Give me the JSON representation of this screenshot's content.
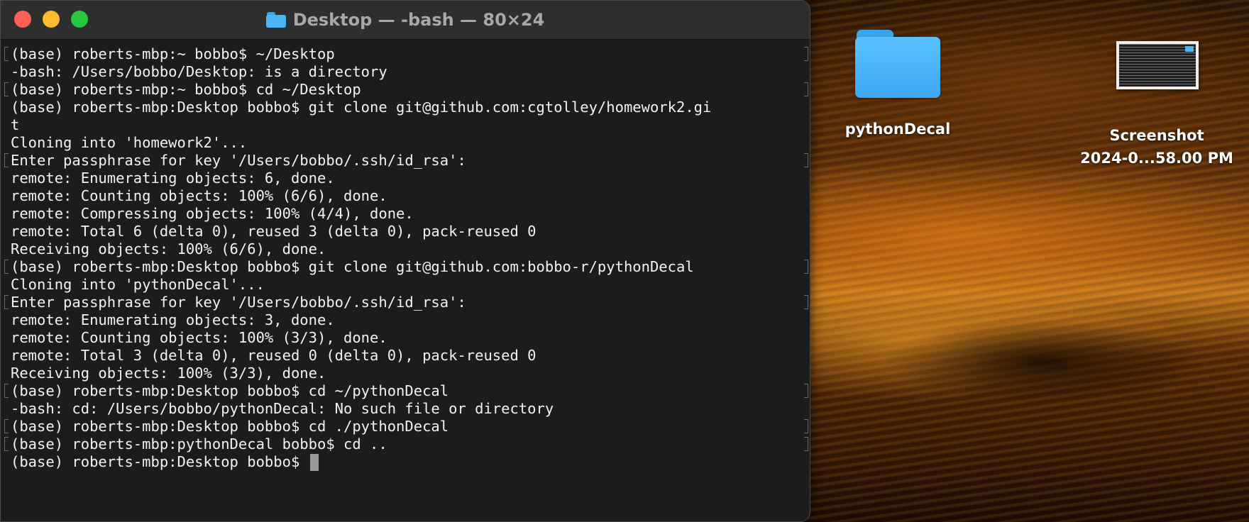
{
  "window": {
    "title": "Desktop — -bash — 80×24",
    "title_icon": "folder-icon"
  },
  "terminal": {
    "lines": [
      {
        "text": "(base) roberts-mbp:~ bobbo$ ~/Desktop",
        "marked": true
      },
      {
        "text": "-bash: /Users/bobbo/Desktop: is a directory",
        "marked": false
      },
      {
        "text": "(base) roberts-mbp:~ bobbo$ cd ~/Desktop",
        "marked": true
      },
      {
        "text": "(base) roberts-mbp:Desktop bobbo$ git clone git@github.com:cgtolley/homework2.gi",
        "marked": false
      },
      {
        "text": "t",
        "marked": false
      },
      {
        "text": "Cloning into 'homework2'...",
        "marked": false
      },
      {
        "text": "Enter passphrase for key '/Users/bobbo/.ssh/id_rsa':",
        "marked": true
      },
      {
        "text": "remote: Enumerating objects: 6, done.",
        "marked": false
      },
      {
        "text": "remote: Counting objects: 100% (6/6), done.",
        "marked": false
      },
      {
        "text": "remote: Compressing objects: 100% (4/4), done.",
        "marked": false
      },
      {
        "text": "remote: Total 6 (delta 0), reused 3 (delta 0), pack-reused 0",
        "marked": false
      },
      {
        "text": "Receiving objects: 100% (6/6), done.",
        "marked": false
      },
      {
        "text": "(base) roberts-mbp:Desktop bobbo$ git clone git@github.com:bobbo-r/pythonDecal",
        "marked": true
      },
      {
        "text": "Cloning into 'pythonDecal'...",
        "marked": false
      },
      {
        "text": "Enter passphrase for key '/Users/bobbo/.ssh/id_rsa':",
        "marked": true
      },
      {
        "text": "remote: Enumerating objects: 3, done.",
        "marked": false
      },
      {
        "text": "remote: Counting objects: 100% (3/3), done.",
        "marked": false
      },
      {
        "text": "remote: Total 3 (delta 0), reused 0 (delta 0), pack-reused 0",
        "marked": false
      },
      {
        "text": "Receiving objects: 100% (3/3), done.",
        "marked": false
      },
      {
        "text": "(base) roberts-mbp:Desktop bobbo$ cd ~/pythonDecal",
        "marked": true
      },
      {
        "text": "-bash: cd: /Users/bobbo/pythonDecal: No such file or directory",
        "marked": false
      },
      {
        "text": "(base) roberts-mbp:Desktop bobbo$ cd ./pythonDecal",
        "marked": true
      },
      {
        "text": "(base) roberts-mbp:pythonDecal bobbo$ cd ..",
        "marked": true
      }
    ],
    "prompt": "(base) roberts-mbp:Desktop bobbo$ "
  },
  "desktop": {
    "folder_label": "pythonDecal",
    "folder_color": "#4ab6f6",
    "screenshot_label_line1": "Screenshot",
    "screenshot_label_line2": "2024-0...58.00 PM"
  },
  "colors": {
    "close": "#fe5f57",
    "minimize": "#febc2e",
    "maximize": "#28c840",
    "terminal_bg": "#1c1c1c",
    "text": "#f2f2f2"
  }
}
